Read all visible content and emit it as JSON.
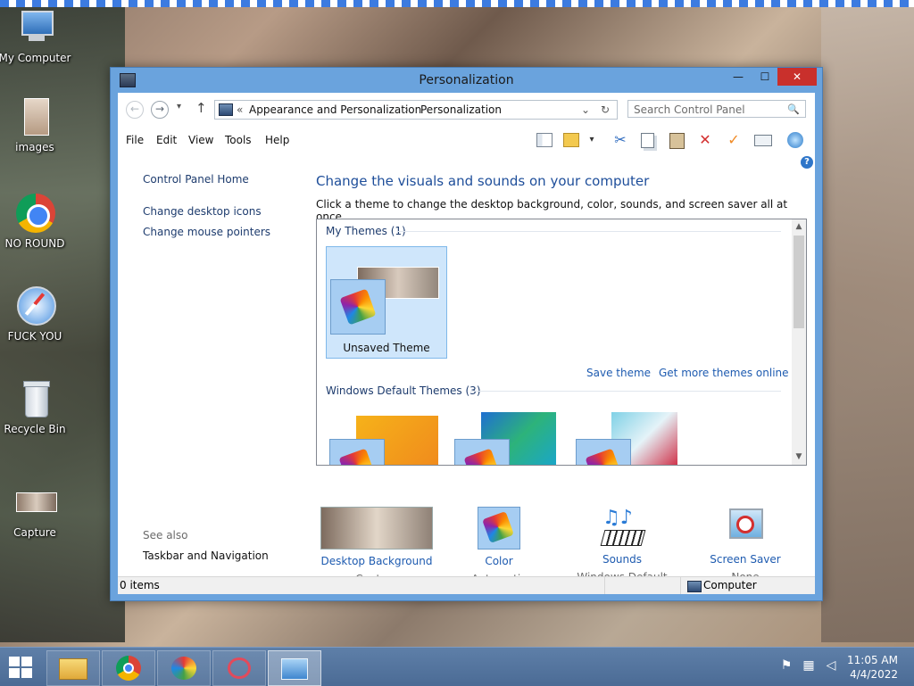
{
  "desktop": {
    "icons": [
      {
        "label": "My Computer"
      },
      {
        "label": "images"
      },
      {
        "label": "NO ROUND"
      },
      {
        "label": "FUCK YOU"
      },
      {
        "label": "Recycle Bin"
      },
      {
        "label": "Capture"
      }
    ]
  },
  "window": {
    "title": "Personalization",
    "controls": {
      "minimize": "—",
      "maximize": "☐",
      "close": "✕"
    },
    "address": {
      "prefix": "«",
      "crumb1": "Appearance and Personalization",
      "separator": "›",
      "crumb2": "Personalization",
      "dropdown": "⌄",
      "refresh": "↻"
    },
    "search": {
      "placeholder": "Search Control Panel",
      "icon": "🔍"
    },
    "menu": [
      "File",
      "Edit",
      "View",
      "Tools",
      "Help"
    ],
    "help": "?",
    "left": {
      "home": "Control Panel Home",
      "links": [
        "Change desktop icons",
        "Change mouse pointers"
      ],
      "see_also": "See also",
      "taskbar_link": "Taskbar and Navigation"
    },
    "main": {
      "heading": "Change the visuals and sounds on your computer",
      "description": "Click a theme to change the desktop background, color, sounds, and screen saver all at once.",
      "my_themes_title": "My Themes (1)",
      "unsaved_theme": "Unsaved Theme",
      "save_theme": "Save theme",
      "get_more": "Get more themes online",
      "default_themes_title": "Windows Default Themes (3)"
    },
    "settings": [
      {
        "title": "Desktop Background",
        "value": "Capture"
      },
      {
        "title": "Color",
        "value": "Automatic"
      },
      {
        "title": "Sounds",
        "value": "Windows Default"
      },
      {
        "title": "Screen Saver",
        "value": "None"
      }
    ],
    "status": {
      "items": "0 items",
      "location": "Computer"
    }
  },
  "taskbar": {
    "time": "11:05 AM",
    "date": "4/4/2022"
  }
}
